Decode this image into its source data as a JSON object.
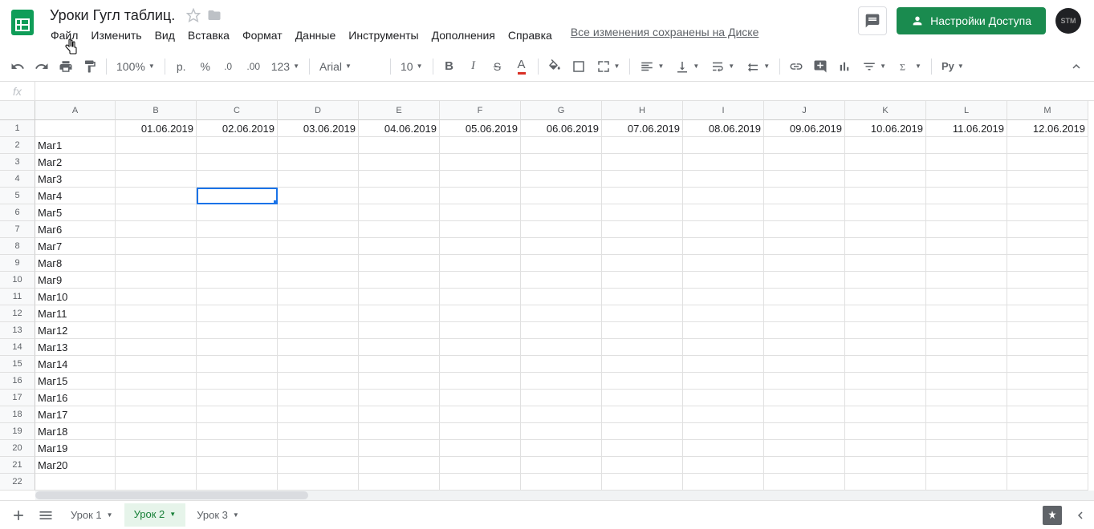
{
  "doc": {
    "title": "Уроки Гугл таблиц."
  },
  "menu": [
    "Файл",
    "Изменить",
    "Вид",
    "Вставка",
    "Формат",
    "Данные",
    "Инструменты",
    "Дополнения",
    "Справка"
  ],
  "save_status": "Все изменения сохранены на Диске",
  "share_label": "Настройки Доступа",
  "avatar_text": "STM",
  "toolbar": {
    "zoom": "100%",
    "currency": "р.",
    "percent": "%",
    "more_formats": "123",
    "font": "Arial",
    "font_size": "10"
  },
  "formula": {
    "fx": "fx",
    "value": ""
  },
  "columns": [
    "A",
    "B",
    "C",
    "D",
    "E",
    "F",
    "G",
    "H",
    "I",
    "J",
    "K",
    "L",
    "M"
  ],
  "rows_count": 22,
  "dates": [
    "01.06.2019",
    "02.06.2019",
    "03.06.2019",
    "04.06.2019",
    "05.06.2019",
    "06.06.2019",
    "07.06.2019",
    "08.06.2019",
    "09.06.2019",
    "10.06.2019",
    "11.06.2019",
    "12.06.2019"
  ],
  "row_labels": [
    "Маг1",
    "Маг2",
    "Маг3",
    "Маг4",
    "Маг5",
    "Маг6",
    "Маг7",
    "Маг8",
    "Маг9",
    "Маг10",
    "Маг11",
    "Маг12",
    "Маг13",
    "Маг14",
    "Маг15",
    "Маг16",
    "Маг17",
    "Маг18",
    "Маг19",
    "Маг20"
  ],
  "selected_cell": "C5",
  "sheets": [
    {
      "name": "Урок 1",
      "active": false
    },
    {
      "name": "Урок 2",
      "active": true
    },
    {
      "name": "Урок 3",
      "active": false
    }
  ]
}
